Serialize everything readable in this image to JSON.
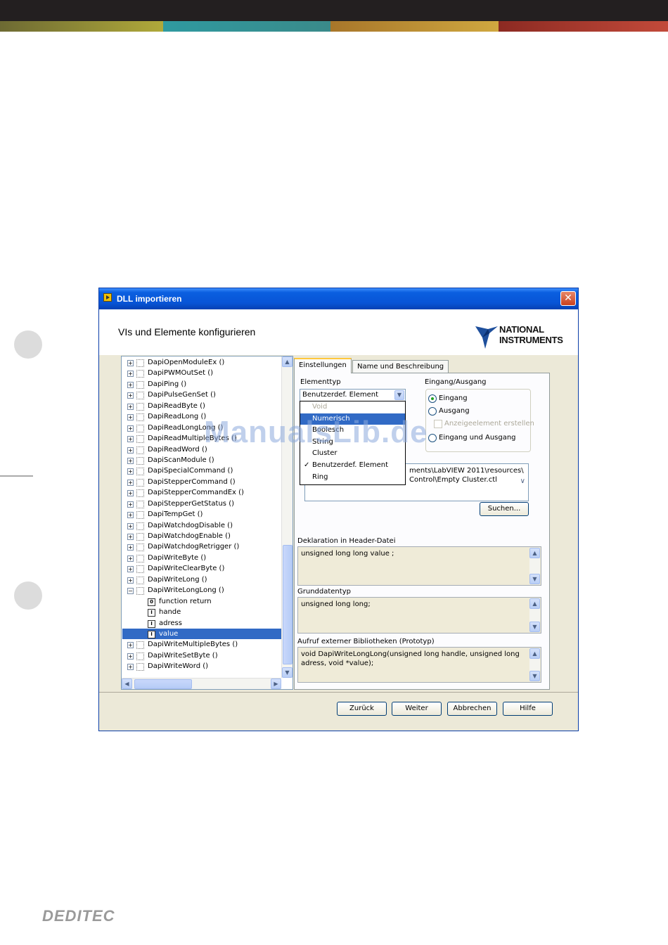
{
  "colors": {
    "top_bar": "#231f20",
    "band": [
      "#b0a93a",
      "#2f9aa0",
      "#c99a32",
      "#b23a2c"
    ],
    "titlebar": "#0854d6",
    "selection": "#316ac5"
  },
  "window": {
    "title": "DLL importieren",
    "header_title": "VIs und Elemente konfigurieren",
    "logo_line1": "NATIONAL",
    "logo_line2": "INSTRUMENTS"
  },
  "tree": {
    "items": [
      {
        "label": "DapiOpenModuleEx ()",
        "type": "function"
      },
      {
        "label": "DapiPWMOutSet ()",
        "type": "function"
      },
      {
        "label": "DapiPing ()",
        "type": "function"
      },
      {
        "label": "DapiPulseGenSet ()",
        "type": "function"
      },
      {
        "label": "DapiReadByte ()",
        "type": "function"
      },
      {
        "label": "DapiReadLong ()",
        "type": "function"
      },
      {
        "label": "DapiReadLongLong ()",
        "type": "function"
      },
      {
        "label": "DapiReadMultipleBytes ()",
        "type": "function"
      },
      {
        "label": "DapiReadWord ()",
        "type": "function"
      },
      {
        "label": "DapiScanModule ()",
        "type": "function"
      },
      {
        "label": "DapiSpecialCommand ()",
        "type": "function"
      },
      {
        "label": "DapiStepperCommand ()",
        "type": "function"
      },
      {
        "label": "DapiStepperCommandEx ()",
        "type": "function"
      },
      {
        "label": "DapiStepperGetStatus ()",
        "type": "function"
      },
      {
        "label": "DapiTempGet ()",
        "type": "function"
      },
      {
        "label": "DapiWatchdogDisable ()",
        "type": "function"
      },
      {
        "label": "DapiWatchdogEnable ()",
        "type": "function"
      },
      {
        "label": "DapiWatchdogRetrigger ()",
        "type": "function"
      },
      {
        "label": "DapiWriteByte ()",
        "type": "function"
      },
      {
        "label": "DapiWriteClearByte ()",
        "type": "function"
      },
      {
        "label": "DapiWriteLong ()",
        "type": "function"
      },
      {
        "label": "DapiWriteLongLong ()",
        "type": "function-open"
      },
      {
        "label": "function return",
        "type": "param",
        "icon": "0"
      },
      {
        "label": "hande",
        "type": "param",
        "icon": "I"
      },
      {
        "label": "adress",
        "type": "param",
        "icon": "I"
      },
      {
        "label": "value",
        "type": "param-selected",
        "icon": "I"
      },
      {
        "label": "DapiWriteMultipleBytes ()",
        "type": "function"
      },
      {
        "label": "DapiWriteSetByte ()",
        "type": "function"
      },
      {
        "label": "DapiWriteWord ()",
        "type": "function"
      }
    ]
  },
  "tabs": {
    "settings": "Einstellungen",
    "name": "Name und Beschreibung"
  },
  "element_type": {
    "label": "Elementtyp",
    "selected": "Benutzerdef. Element",
    "options": [
      {
        "label": "Void",
        "state": "disabled",
        "checked": ""
      },
      {
        "label": "Numerisch",
        "state": "active",
        "checked": ""
      },
      {
        "label": "Boolesch",
        "state": "",
        "checked": ""
      },
      {
        "label": "String",
        "state": "",
        "checked": ""
      },
      {
        "label": "Cluster",
        "state": "",
        "checked": ""
      },
      {
        "label": "Benutzerdef. Element",
        "state": "",
        "checked": "✓"
      },
      {
        "label": "Ring",
        "state": "",
        "checked": ""
      }
    ]
  },
  "io": {
    "label": "Eingang/Ausgang",
    "input": "Eingang",
    "output": "Ausgang",
    "create_indicator": "Anzeigeelement erstellen",
    "in_out": "Eingang und Ausgang"
  },
  "path": {
    "line1": "ments\\LabVIEW 2011\\resources\\",
    "line2": "Control\\Empty Cluster.ctl"
  },
  "buttons": {
    "search": "Suchen...",
    "back": "Zurück",
    "next": "Weiter",
    "cancel": "Abbrechen",
    "help": "Hilfe"
  },
  "declaration": {
    "label": "Deklaration in Header-Datei",
    "value": "unsigned long long  value ;"
  },
  "base_type": {
    "label": "Grunddatentyp",
    "value": "unsigned long long;"
  },
  "prototype": {
    "label": "Aufruf externer Bibliotheken (Prototyp)",
    "line1": "void  DapiWriteLongLong(unsigned long handle, unsigned long",
    "line2": "adress, void *value);"
  },
  "watermark": "ManualsLib.de",
  "footer_logo": "DEDITEC"
}
